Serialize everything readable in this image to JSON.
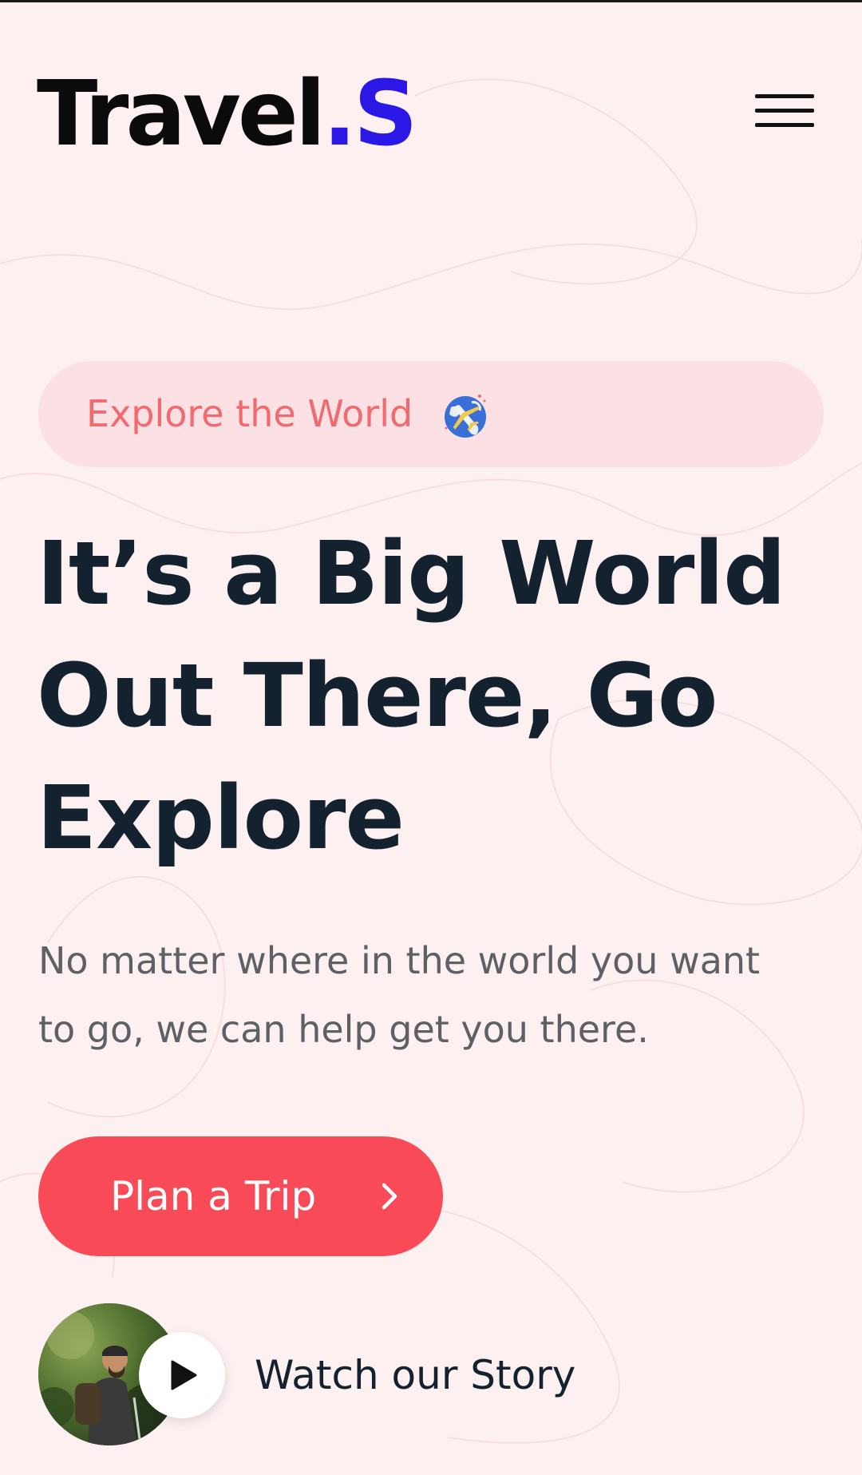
{
  "header": {
    "logo_main": "Travel",
    "logo_accent": ".S",
    "menu_icon": "hamburger-menu-icon"
  },
  "hero": {
    "badge_text": "Explore the World",
    "badge_icon": "globe-airplane-icon",
    "headline_lines": [
      "It’s a Big World",
      "Out There, Go",
      "Explore"
    ],
    "subtext": "No matter where in the world you want to go, we can help get you there.",
    "cta_label": "Plan a Trip",
    "cta_icon": "chevron-right-icon",
    "story_label": "Watch our Story",
    "story_icon": "play-icon"
  },
  "colors": {
    "background": "#fdf0f0",
    "logo_accent": "#2b17e6",
    "badge_bg": "#fbe1e3",
    "badge_text": "#f06a6f",
    "headline": "#14212f",
    "body_text": "#5e6066",
    "cta_bg": "#f94b57"
  }
}
